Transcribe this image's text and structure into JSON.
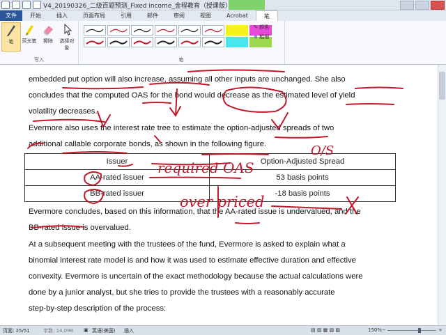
{
  "window": {
    "title": "V4_20190326_二级百题预测_Fixed income_金程教育（授课版） - M...",
    "contextual_tab": "笔"
  },
  "tabs": [
    {
      "label": "文件"
    },
    {
      "label": "开始"
    },
    {
      "label": "插入"
    },
    {
      "label": "页面布局"
    },
    {
      "label": "引用"
    },
    {
      "label": "邮件"
    },
    {
      "label": "审阅"
    },
    {
      "label": "视图"
    },
    {
      "label": "Acrobat"
    },
    {
      "label": "笔"
    }
  ],
  "ribbon": {
    "write_group": "写入",
    "pens_group": "笔",
    "tools": {
      "pen": "笔",
      "highlighter": "荧光笔",
      "eraser": "擦除",
      "select": "选择对象"
    },
    "color_btn": "颜色",
    "weight_btn": "粗细",
    "highlight_colors": [
      "#f7f11c",
      "#49e6ef",
      "#e64bd8",
      "#9bd94b"
    ]
  },
  "document": {
    "para1": [
      "embedded put option will also increase, assuming all other inputs are unchanged. She also",
      "concludes that the computed OAS for the bond would decrease as the estimated level of yield",
      "volatility decreases."
    ],
    "para2": [
      "Evermore also uses the interest rate tree to estimate the option-adjusted spreads of two",
      "additional callable corporate bonds, as shown in the following figure."
    ],
    "table": {
      "headers": [
        "Issuer",
        "Option-Adjusted Spread"
      ],
      "rows": [
        [
          "AA-rated issuer",
          "53 basis points"
        ],
        [
          "BB-rated issuer",
          "-18 basis points"
        ]
      ]
    },
    "para3": [
      "Evermore concludes, based on this information, that the AA-rated issue is undervalued, and the",
      "BB-rated issue is overvalued."
    ],
    "para4": [
      "At a subsequent meeting with the trustees of the fund, Evermore is asked to explain what a",
      "binomial interest rate model is and how it was used to estimate effective duration and effective",
      "convexity. Evermore is uncertain of the exact methodology because the actual calculations were",
      "done by a junior analyst, but she tries to provide the trustees with a reasonably accurate",
      "step-by-step description of the process:"
    ],
    "ink_notes": {
      "note1": "O/S",
      "note2": "required OAS",
      "note3": "over priced"
    }
  },
  "status": {
    "page": "页面: 25/51",
    "words": "字数: 14,098",
    "lang": "英语(美国)",
    "mode": "插入",
    "zoom": "150%"
  }
}
